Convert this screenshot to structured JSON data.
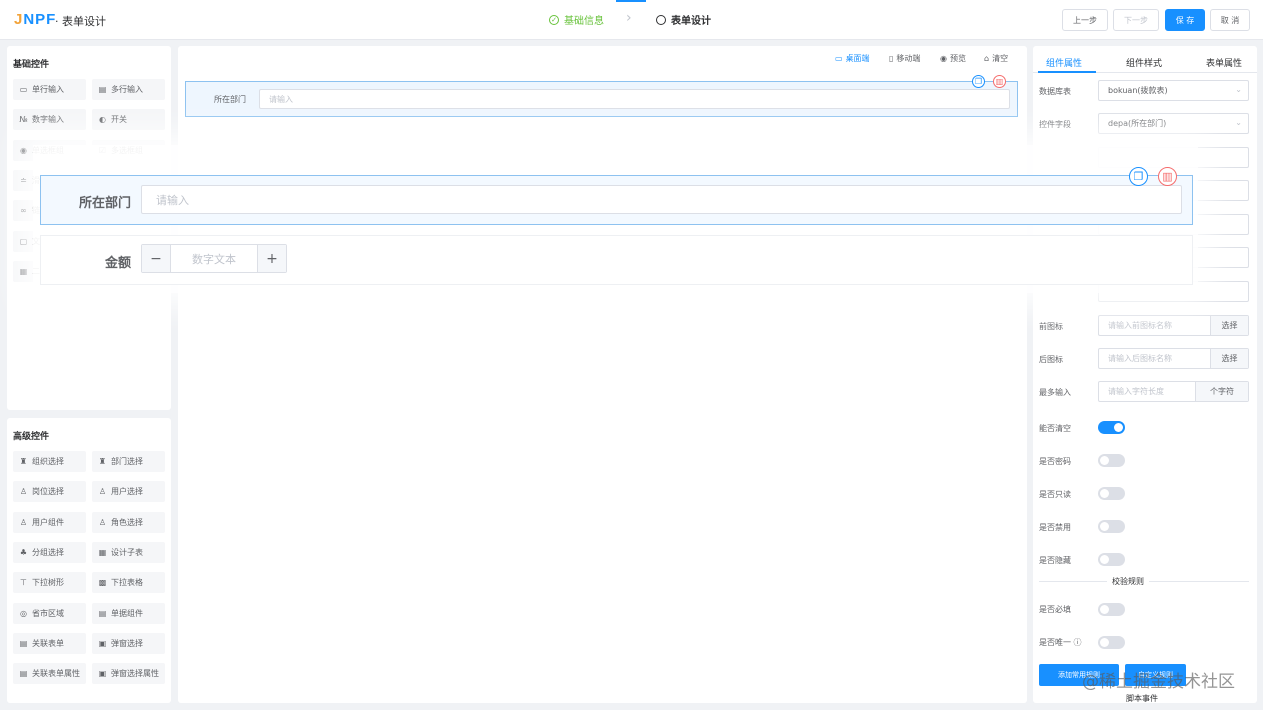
{
  "header": {
    "logo_text": "JNPF",
    "title": "· 表单设计",
    "steps": [
      "基础信息",
      "表单设计"
    ],
    "buttons": {
      "prev": "上一步",
      "next": "下一步",
      "save": "保 存",
      "cancel": "取 消"
    }
  },
  "basic_controls": {
    "title": "基础控件",
    "items": [
      {
        "icon": "single-line-input-icon",
        "glyph": "▭",
        "label": "单行输入"
      },
      {
        "icon": "multi-line-input-icon",
        "glyph": "▤",
        "label": "多行输入"
      },
      {
        "icon": "number-input-icon",
        "glyph": "№",
        "label": "数字输入"
      },
      {
        "icon": "switch-icon",
        "glyph": "◐",
        "label": "开关"
      },
      {
        "icon": "radio-icon",
        "glyph": "◉",
        "label": "单选框组"
      },
      {
        "icon": "checkbox-icon",
        "glyph": "☑",
        "label": "多选框组"
      },
      {
        "icon": "slider-icon",
        "glyph": "≐",
        "label": "滑块"
      },
      {
        "icon": "rich-text-icon",
        "glyph": "▣",
        "label": "富文本"
      },
      {
        "icon": "link-icon",
        "glyph": "∞",
        "label": "链接"
      },
      {
        "icon": "button-icon",
        "glyph": "▭",
        "label": "按钮"
      },
      {
        "icon": "text-icon",
        "glyph": "▢",
        "label": "文本"
      },
      {
        "icon": "alert-icon",
        "glyph": "ⓘ",
        "label": "提示"
      },
      {
        "icon": "qrcode-icon",
        "glyph": "▦",
        "label": "二维码"
      },
      {
        "icon": "barcode-icon",
        "glyph": "▥",
        "label": "条形码"
      }
    ]
  },
  "advanced_controls": {
    "title": "高级控件",
    "items": [
      {
        "icon": "org-select-icon",
        "glyph": "♜",
        "label": "组织选择"
      },
      {
        "icon": "dept-select-icon",
        "glyph": "♜",
        "label": "部门选择"
      },
      {
        "icon": "position-select-icon",
        "glyph": "♙",
        "label": "岗位选择"
      },
      {
        "icon": "user-select-icon",
        "glyph": "♙",
        "label": "用户选择"
      },
      {
        "icon": "user-component-icon",
        "glyph": "♙",
        "label": "用户组件"
      },
      {
        "icon": "role-select-icon",
        "glyph": "♙",
        "label": "角色选择"
      },
      {
        "icon": "group-select-icon",
        "glyph": "♣",
        "label": "分组选择"
      },
      {
        "icon": "sub-table-icon",
        "glyph": "▦",
        "label": "设计子表"
      },
      {
        "icon": "tree-select-icon",
        "glyph": "⊤",
        "label": "下拉树形"
      },
      {
        "icon": "dropdown-table-icon",
        "glyph": "▩",
        "label": "下拉表格"
      },
      {
        "icon": "region-icon",
        "glyph": "◎",
        "label": "省市区域"
      },
      {
        "icon": "bill-number-icon",
        "glyph": "▤",
        "label": "单据组件"
      },
      {
        "icon": "related-form-icon",
        "glyph": "▤",
        "label": "关联表单"
      },
      {
        "icon": "popup-select-icon",
        "glyph": "▣",
        "label": "弹窗选择"
      },
      {
        "icon": "related-form-attr-icon",
        "glyph": "▤",
        "label": "关联表单属性"
      },
      {
        "icon": "popup-attr-icon",
        "glyph": "▣",
        "label": "弹窗选择属性"
      }
    ]
  },
  "canvas": {
    "toolbar": [
      {
        "icon": "desktop-icon",
        "glyph": "▭",
        "label": "桌面端"
      },
      {
        "icon": "mobile-icon",
        "glyph": "▯",
        "label": "移动端"
      },
      {
        "icon": "preview-icon",
        "glyph": "◉",
        "label": "预览"
      },
      {
        "icon": "clear-icon",
        "glyph": "⌂",
        "label": "清空"
      }
    ],
    "field1": {
      "label": "所在部门",
      "placeholder": "请输入"
    },
    "field2": {
      "label": "金额",
      "placeholder": "数字文本",
      "minus": "−",
      "plus": "+"
    }
  },
  "properties": {
    "tabs": [
      "组件属性",
      "组件样式",
      "表单属性"
    ],
    "db_table": {
      "label": "数据库表",
      "value": "bokuan(拨款表)"
    },
    "field": {
      "label": "控件字段",
      "value": "depa(所在部门)"
    },
    "prefix_icon": {
      "label": "前图标",
      "placeholder": "请输入前图标名称",
      "button": "选择"
    },
    "suffix_icon": {
      "label": "后图标",
      "placeholder": "请输入后图标名称",
      "button": "选择"
    },
    "max_length": {
      "label": "最多输入",
      "placeholder": "请输入字符长度",
      "unit": "个字符"
    },
    "switches": [
      {
        "label": "能否清空",
        "on": true
      },
      {
        "label": "是否密码",
        "on": false
      },
      {
        "label": "是否只读",
        "on": false
      },
      {
        "label": "是否禁用",
        "on": false
      },
      {
        "label": "是否隐藏",
        "on": false
      }
    ],
    "validation_title": "校验规则",
    "required": {
      "label": "是否必填",
      "on": false
    },
    "unique": {
      "label": "是否唯一",
      "on": false
    },
    "add_rule_button": "添加常用规则",
    "custom_rule_button": "自定义规则",
    "script_event": "脚本事件"
  },
  "watermark": "@稀土掘金技术社区",
  "colors": {
    "primary": "#1890ff",
    "success": "#67c23a",
    "danger": "#f56c6c"
  }
}
